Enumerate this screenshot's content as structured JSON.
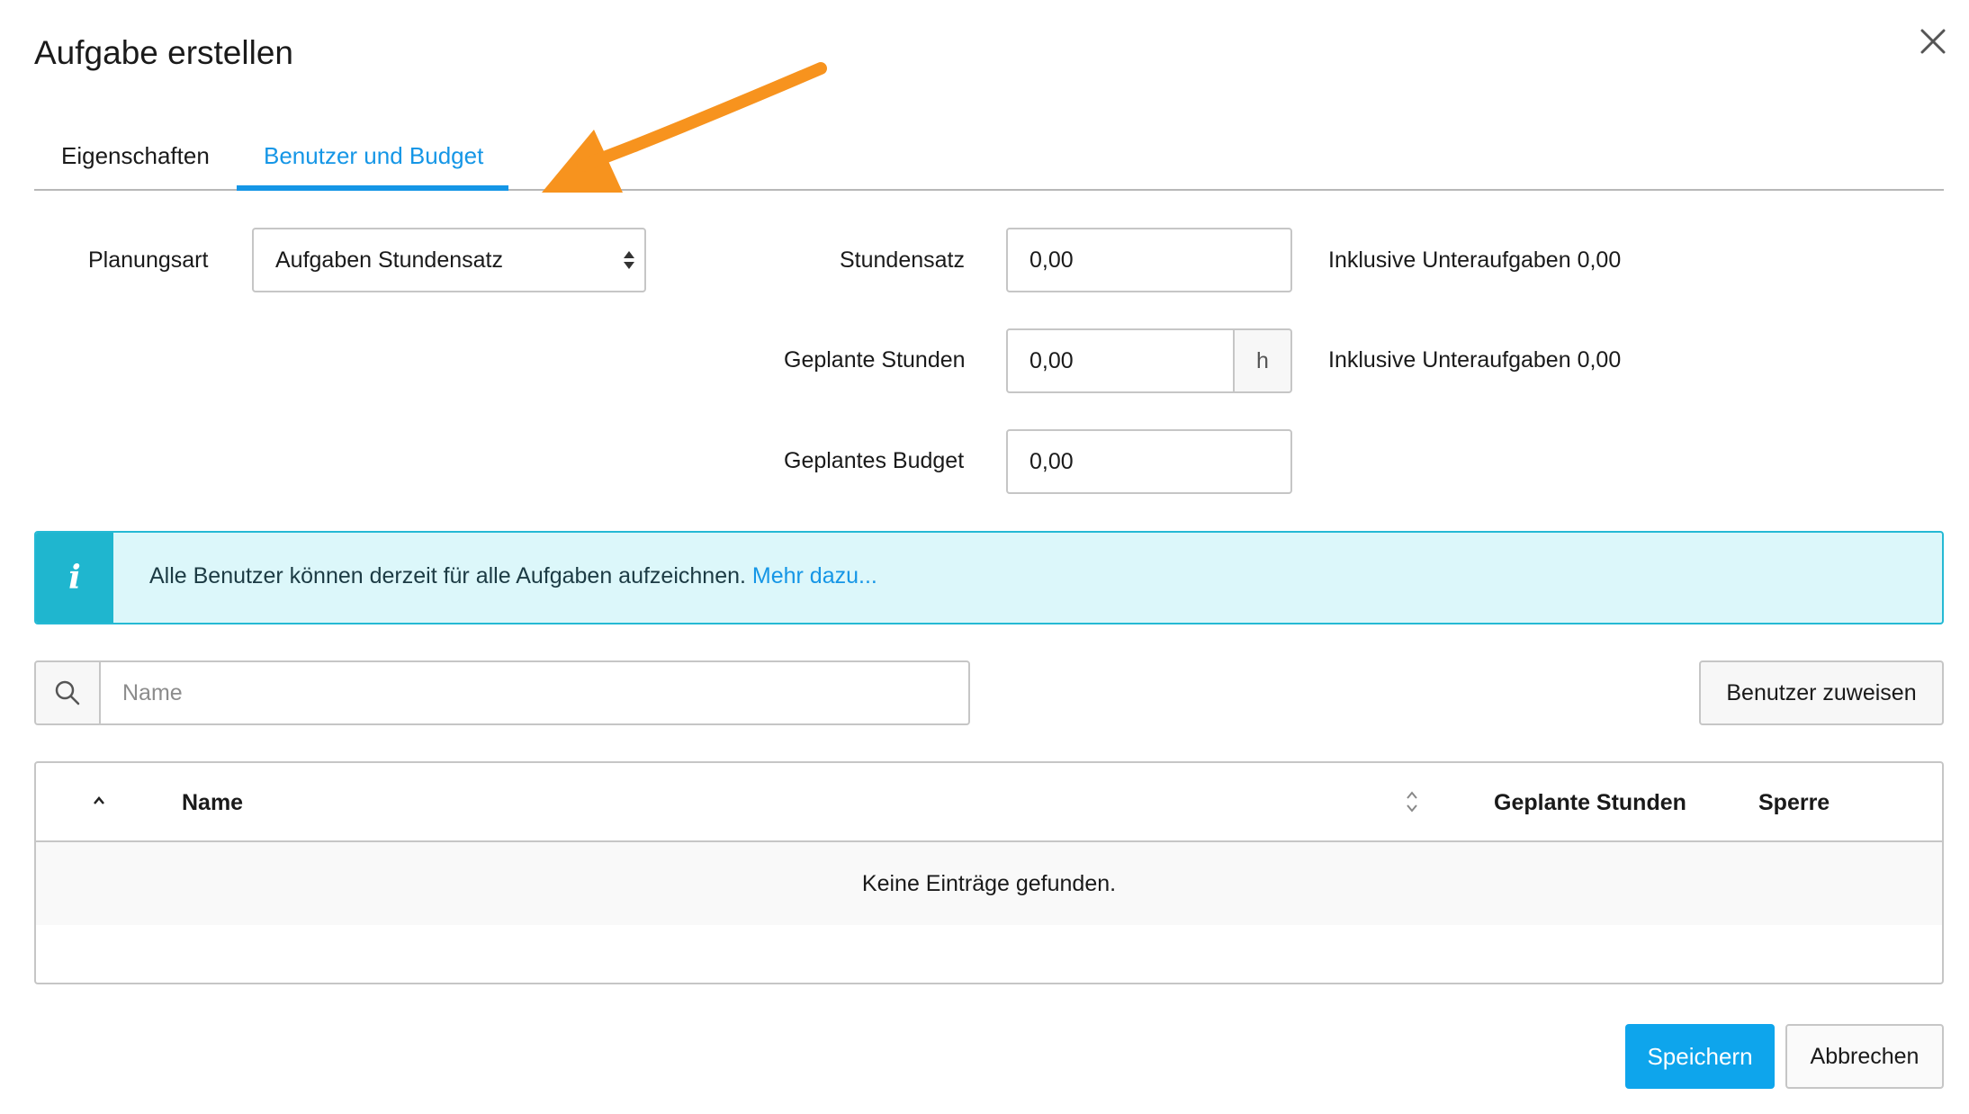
{
  "dialog": {
    "title": "Aufgabe erstellen",
    "close_icon": "close-icon"
  },
  "tabs": [
    {
      "label": "Eigenschaften",
      "active": false
    },
    {
      "label": "Benutzer und Budget",
      "active": true
    }
  ],
  "form": {
    "planning_type": {
      "label": "Planungsart",
      "value": "Aufgaben Stundensatz"
    },
    "hourly_rate": {
      "label": "Stundensatz",
      "value": "0,00",
      "note": "Inklusive Unteraufgaben 0,00"
    },
    "planned_hours": {
      "label": "Geplante Stunden",
      "value": "0,00",
      "unit": "h",
      "note": "Inklusive Unteraufgaben 0,00"
    },
    "planned_budget": {
      "label": "Geplantes Budget",
      "value": "0,00"
    }
  },
  "info": {
    "icon": "info-icon",
    "text": "Alle Benutzer können derzeit für alle Aufgaben aufzeichnen.",
    "link": "Mehr dazu..."
  },
  "search": {
    "placeholder": "Name",
    "icon": "search-icon"
  },
  "assign_button": "Benutzer zuweisen",
  "table": {
    "columns": [
      "Name",
      "Geplante Stunden",
      "Sperre"
    ],
    "empty_text": "Keine Einträge gefunden."
  },
  "footer": {
    "save": "Speichern",
    "cancel": "Abbrechen"
  },
  "colors": {
    "accent": "#1596e6",
    "primary_button": "#0ea5ec",
    "info_bar": "#1fb6cf",
    "info_background": "#dcf7fa",
    "annotation_arrow": "#f7931e"
  }
}
